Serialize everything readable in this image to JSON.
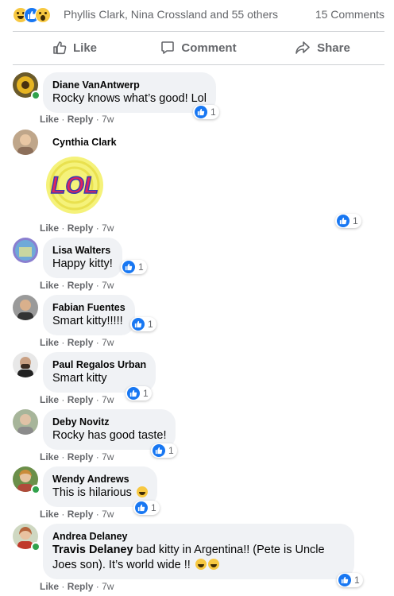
{
  "summary": {
    "names": "Phyllis Clark, Nina Crossland and 55 others",
    "comment_count": "15 Comments",
    "reactions": [
      "haha-icon",
      "like-icon",
      "wow-icon"
    ]
  },
  "actions": {
    "like": "Like",
    "comment": "Comment",
    "share": "Share"
  },
  "labels": {
    "like": "Like",
    "reply": "Reply",
    "sep": "·"
  },
  "comments": [
    {
      "author": "Diane VanAntwerp",
      "text": "Rocky knows what’s good! Lol",
      "time": "7w",
      "reactions": "1",
      "online": true
    },
    {
      "author": "Cynthia Clark",
      "text": "",
      "sticker_text": "LOL",
      "time": "7w",
      "reactions": "1",
      "online": false
    },
    {
      "author": "Lisa Walters",
      "text": "Happy kitty!",
      "time": "7w",
      "reactions": "1",
      "online": false
    },
    {
      "author": "Fabian Fuentes",
      "text": "Smart kitty!!!!!",
      "time": "7w",
      "reactions": "1",
      "online": false
    },
    {
      "author": "Paul Regalos Urban",
      "text": "Smart kitty",
      "time": "7w",
      "reactions": "1",
      "online": false
    },
    {
      "author": "Deby Novitz",
      "text": "Rocky has good taste!",
      "time": "7w",
      "reactions": "1",
      "online": false
    },
    {
      "author": "Wendy Andrews",
      "text": "This is hilarious",
      "time": "7w",
      "reactions": "1",
      "online": true
    },
    {
      "author": "Andrea Delaney",
      "mention": "Travis Delaney",
      "text": " bad kitty in Argentina!! (Pete is Uncle Joes son). It’s world wide !! ",
      "time": "7w",
      "reactions": "1",
      "online": true
    }
  ],
  "colors": {
    "accent": "#1877f2",
    "bubble": "#f0f2f5",
    "meta": "#65676b",
    "online": "#31a24c"
  }
}
